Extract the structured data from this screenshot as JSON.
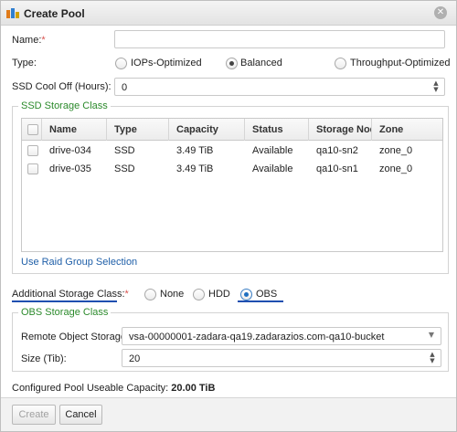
{
  "dialog": {
    "title": "Create Pool",
    "close_glyph": "✕"
  },
  "form": {
    "name_label": "Name:",
    "required_mark": "*",
    "name_value": "",
    "type_label": "Type:",
    "type_options": [
      "IOPs-Optimized",
      "Balanced",
      "Throughput-Optimized"
    ],
    "type_selected": "Balanced",
    "ssd_cooloff_label": "SSD Cool Off (Hours):",
    "ssd_cooloff_value": "0"
  },
  "ssd_storage": {
    "legend": "SSD Storage Class",
    "columns": [
      "Name",
      "Type",
      "Capacity",
      "Status",
      "Storage Node",
      "Zone"
    ],
    "rows": [
      {
        "name": "drive-034",
        "type": "SSD",
        "capacity": "3.49 TiB",
        "status": "Available",
        "node": "qa10-sn2",
        "zone": "zone_0"
      },
      {
        "name": "drive-035",
        "type": "SSD",
        "capacity": "3.49 TiB",
        "status": "Available",
        "node": "qa10-sn1",
        "zone": "zone_0"
      }
    ],
    "raid_link": "Use Raid Group Selection"
  },
  "additional": {
    "label": "Additional Storage Class:",
    "options": [
      "None",
      "HDD",
      "OBS"
    ],
    "selected": "OBS"
  },
  "obs_storage": {
    "legend": "OBS Storage Class",
    "remote_label": "Remote Object Storage:",
    "remote_value": "vsa-00000001-zadara-qa19.zadarazios.com-qa10-bucket",
    "size_label": "Size (Tib):",
    "size_value": "20"
  },
  "capacity": {
    "label": "Configured Pool Useable Capacity:",
    "value": "20.00 TiB"
  },
  "buttons": {
    "create": "Create",
    "cancel": "Cancel"
  },
  "icons": {
    "app": "pool-icon",
    "close": "close-icon"
  }
}
